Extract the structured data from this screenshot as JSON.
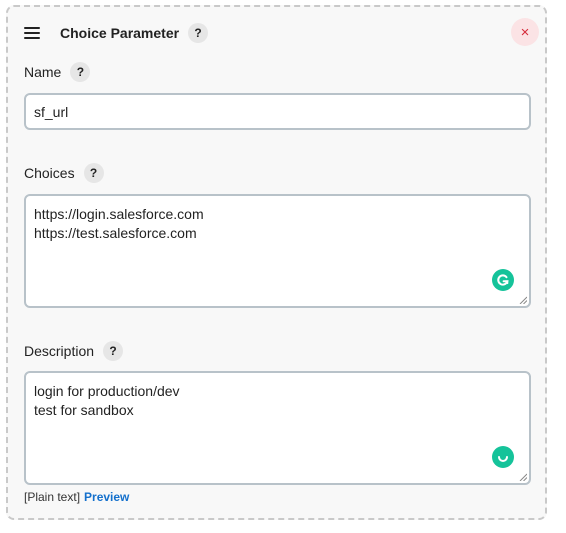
{
  "panel": {
    "title": "Choice Parameter",
    "help_label": "?",
    "close_label": "×"
  },
  "name_field": {
    "label": "Name",
    "help_label": "?",
    "value": "sf_url"
  },
  "choices_field": {
    "label": "Choices",
    "help_label": "?",
    "lines": [
      "https://login.salesforce.com",
      "https://test.salesforce.com"
    ]
  },
  "description_field": {
    "label": "Description",
    "help_label": "?",
    "lines": [
      "login for production/dev",
      "test for sandbox"
    ]
  },
  "footer": {
    "plain_text_label": "[Plain text]",
    "preview_link": "Preview"
  },
  "colors": {
    "panel_background": "#f8f8f8",
    "close_button_background": "#fbe3e5",
    "close_button_color": "#d52b3b",
    "grammarly_green": "#15c39a",
    "link_blue": "#1470cc"
  }
}
